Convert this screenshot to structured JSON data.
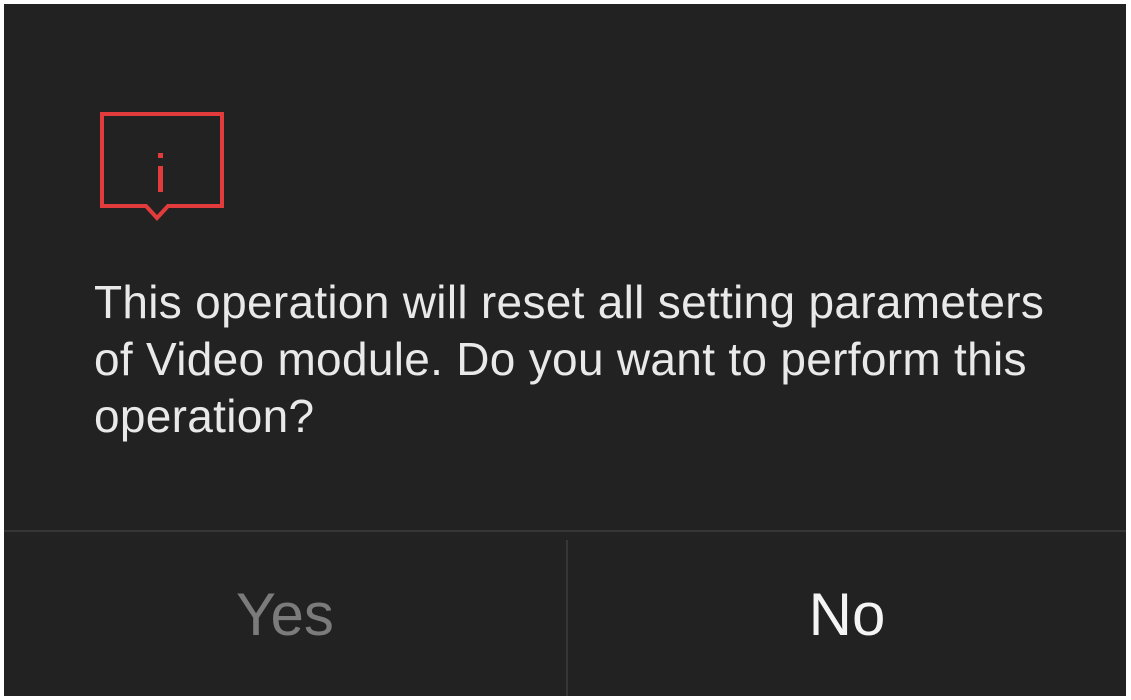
{
  "dialog": {
    "icon": "info-alert-icon",
    "accent_color": "#e23b3b",
    "message": "This operation will reset all setting parameters of Video module. Do you want to perform this operation?",
    "buttons": {
      "yes_label": "Yes",
      "no_label": "No"
    }
  }
}
